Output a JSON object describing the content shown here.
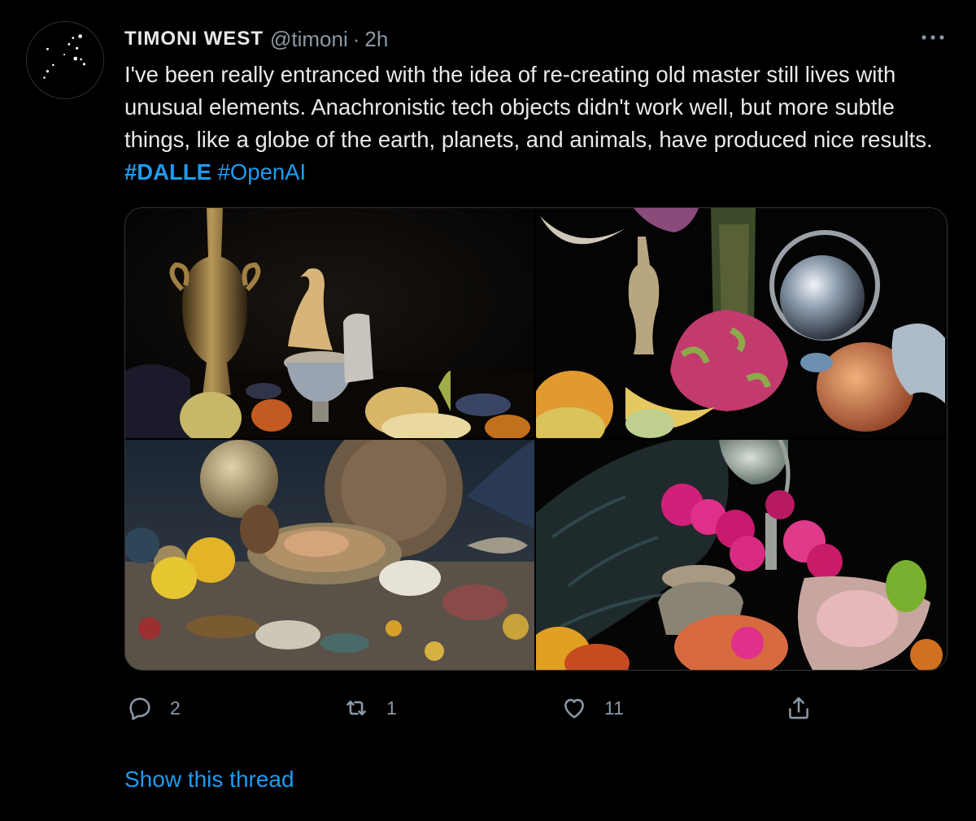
{
  "tweet": {
    "author": {
      "display_name": "TIMONI WEST",
      "handle": "@timoni",
      "separator": "·",
      "time": "2h",
      "avatar_icon": "constellation-avatar-icon"
    },
    "more_icon": "more-horizontal-icon",
    "text": {
      "body": "I've been really entranced with the idea of re-creating old master still lives with unusual elements. Anachronistic tech objects didn't work well, but more subtle things, like a globe of the earth, planets, and animals, have produced nice results.",
      "hashtags": [
        "#DALLE",
        "#OpenAI"
      ]
    },
    "media": {
      "photos": [
        {
          "subject": "still-life-giraffe-vase"
        },
        {
          "subject": "still-life-moon-orb"
        },
        {
          "subject": "still-life-planets-table"
        },
        {
          "subject": "still-life-globe-flowers"
        }
      ]
    },
    "actions": {
      "reply": {
        "icon": "reply-icon",
        "count": "2"
      },
      "retweet": {
        "icon": "retweet-icon",
        "count": "1"
      },
      "like": {
        "icon": "heart-icon",
        "count": "11"
      },
      "share": {
        "icon": "share-icon"
      }
    },
    "show_thread_label": "Show this thread",
    "colors": {
      "background": "#000000",
      "text": "#e7e9ea",
      "muted": "#8b98a5",
      "accent": "#1d9bf0"
    }
  }
}
